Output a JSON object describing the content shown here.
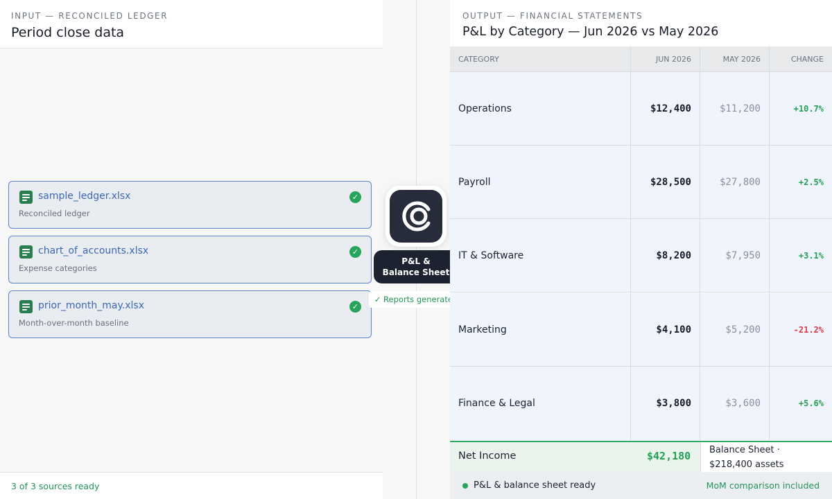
{
  "input": {
    "eyebrow": "INPUT — RECONCILED LEDGER",
    "title": "Period close data",
    "files": [
      {
        "name": "sample_ledger.xlsx",
        "sub": "Reconciled ledger",
        "icon": "spreadsheet-icon",
        "status": "ready"
      },
      {
        "name": "chart_of_accounts.xlsx",
        "sub": "Expense categories",
        "icon": "spreadsheet-icon",
        "status": "ready"
      },
      {
        "name": "prior_month_may.xlsx",
        "sub": "Month-over-month baseline",
        "icon": "spreadsheet-icon",
        "status": "ready"
      }
    ],
    "footer": "3 of 3 sources ready"
  },
  "hub": {
    "icon": "app-logo-icon",
    "label_line1": "P&L &",
    "label_line2": "Balance Sheet",
    "status": "✓ Reports generated"
  },
  "output": {
    "eyebrow": "OUTPUT — FINANCIAL STATEMENTS",
    "title": "P&L by Category — Jun 2026 vs May 2026",
    "columns": [
      "CATEGORY",
      "JUN 2026",
      "MAY 2026",
      "CHANGE"
    ],
    "rows": [
      {
        "category": "Operations",
        "current": "$12,400",
        "previous": "$11,200",
        "change": "+10.7%"
      },
      {
        "category": "Payroll",
        "current": "$28,500",
        "previous": "$27,800",
        "change": "+2.5%"
      },
      {
        "category": "IT & Software",
        "current": "$8,200",
        "previous": "$7,950",
        "change": "+3.1%"
      },
      {
        "category": "Marketing",
        "current": "$4,100",
        "previous": "$5,200",
        "change": "-21.2%"
      },
      {
        "category": "Finance & Legal",
        "current": "$3,800",
        "previous": "$3,600",
        "change": "+5.6%"
      }
    ],
    "total": {
      "label": "Net Income",
      "value": "$42,180",
      "balance_line1": "Balance Sheet ·",
      "balance_line2": "$218,400 assets"
    },
    "footer_left": "P&L & balance sheet ready",
    "footer_right": "MoM comparison included"
  },
  "colors": {
    "accent_blue": "#3c67b3",
    "success_green": "#23a053",
    "negative_red": "#d9363e",
    "hub_dark": "#1d2230"
  }
}
